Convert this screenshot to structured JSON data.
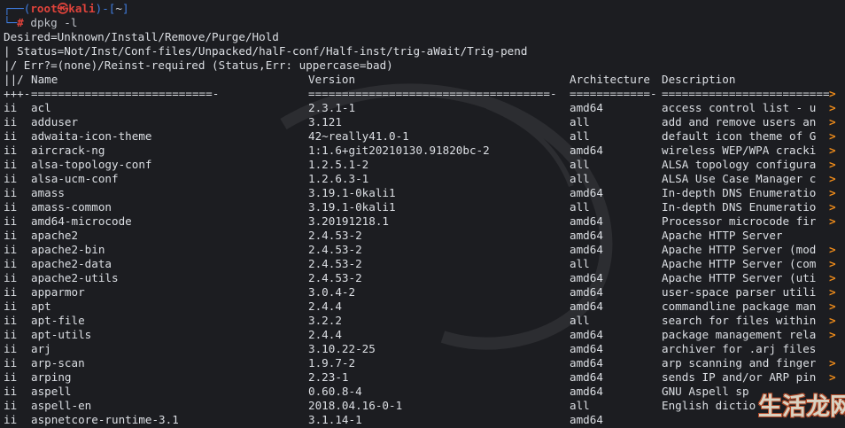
{
  "prompt": {
    "box_top": "┌──(",
    "user": "root㉿kali",
    "mid": ")-[",
    "cwd": "~",
    "close": "]",
    "box_bottom": "└─",
    "symbol": "#",
    "command": "dpkg -l"
  },
  "header": {
    "desired": "Desired=Unknown/Install/Remove/Purge/Hold",
    "status": "| Status=Not/Inst/Conf-files/Unpacked/halF-conf/Half-inst/trig-aWait/Trig-pend",
    "err": "|/ Err?=(none)/Reinst-required (Status,Err: uppercase=bad)",
    "col_flags": "||/",
    "col_name": "Name",
    "col_version": "Version",
    "col_arch": "Architecture",
    "col_desc": "Description",
    "rule_flags": "+++-",
    "rule_name": "===========================-",
    "rule_version": "====================================-",
    "rule_arch": "============-",
    "rule_desc": "===========================",
    "overflow_arrow": ">"
  },
  "packages": [
    {
      "status": "ii",
      "name": "acl",
      "version": "2.3.1-1",
      "arch": "amd64",
      "desc": "access control list - u",
      "more": ">"
    },
    {
      "status": "ii",
      "name": "adduser",
      "version": "3.121",
      "arch": "all",
      "desc": "add and remove users an",
      "more": ">"
    },
    {
      "status": "ii",
      "name": "adwaita-icon-theme",
      "version": "42~really41.0-1",
      "arch": "all",
      "desc": "default icon theme of G",
      "more": ">"
    },
    {
      "status": "ii",
      "name": "aircrack-ng",
      "version": "1:1.6+git20210130.91820bc-2",
      "arch": "amd64",
      "desc": "wireless WEP/WPA cracki",
      "more": ">"
    },
    {
      "status": "ii",
      "name": "alsa-topology-conf",
      "version": "1.2.5.1-2",
      "arch": "all",
      "desc": "ALSA topology configura",
      "more": ">"
    },
    {
      "status": "ii",
      "name": "alsa-ucm-conf",
      "version": "1.2.6.3-1",
      "arch": "all",
      "desc": "ALSA Use Case Manager c",
      "more": ">"
    },
    {
      "status": "ii",
      "name": "amass",
      "version": "3.19.1-0kali1",
      "arch": "amd64",
      "desc": "In-depth DNS Enumeratio",
      "more": ">"
    },
    {
      "status": "ii",
      "name": "amass-common",
      "version": "3.19.1-0kali1",
      "arch": "all",
      "desc": "In-depth DNS Enumeratio",
      "more": ">"
    },
    {
      "status": "ii",
      "name": "amd64-microcode",
      "version": "3.20191218.1",
      "arch": "amd64",
      "desc": "Processor microcode fir",
      "more": ">"
    },
    {
      "status": "ii",
      "name": "apache2",
      "version": "2.4.53-2",
      "arch": "amd64",
      "desc": "Apache HTTP Server",
      "more": ""
    },
    {
      "status": "ii",
      "name": "apache2-bin",
      "version": "2.4.53-2",
      "arch": "amd64",
      "desc": "Apache HTTP Server (mod",
      "more": ">"
    },
    {
      "status": "ii",
      "name": "apache2-data",
      "version": "2.4.53-2",
      "arch": "all",
      "desc": "Apache HTTP Server (com",
      "more": ">"
    },
    {
      "status": "ii",
      "name": "apache2-utils",
      "version": "2.4.53-2",
      "arch": "amd64",
      "desc": "Apache HTTP Server (uti",
      "more": ">"
    },
    {
      "status": "ii",
      "name": "apparmor",
      "version": "3.0.4-2",
      "arch": "amd64",
      "desc": "user-space parser utili",
      "more": ">"
    },
    {
      "status": "ii",
      "name": "apt",
      "version": "2.4.4",
      "arch": "amd64",
      "desc": "commandline package man",
      "more": ">"
    },
    {
      "status": "ii",
      "name": "apt-file",
      "version": "3.2.2",
      "arch": "all",
      "desc": "search for files within",
      "more": ">"
    },
    {
      "status": "ii",
      "name": "apt-utils",
      "version": "2.4.4",
      "arch": "amd64",
      "desc": "package management rela",
      "more": ">"
    },
    {
      "status": "ii",
      "name": "arj",
      "version": "3.10.22-25",
      "arch": "amd64",
      "desc": "archiver for .arj files",
      "more": ""
    },
    {
      "status": "ii",
      "name": "arp-scan",
      "version": "1.9.7-2",
      "arch": "amd64",
      "desc": "arp scanning and finger",
      "more": ">"
    },
    {
      "status": "ii",
      "name": "arping",
      "version": "2.23-1",
      "arch": "amd64",
      "desc": "sends IP and/or ARP pin",
      "more": ">"
    },
    {
      "status": "ii",
      "name": "aspell",
      "version": "0.60.8-4",
      "arch": "amd64",
      "desc": "GNU Aspell sp",
      "more": ""
    },
    {
      "status": "ii",
      "name": "aspell-en",
      "version": "2018.04.16-0-1",
      "arch": "all",
      "desc": "English dictio",
      "more": ""
    },
    {
      "status": "ii",
      "name": "aspnetcore-runtime-3.1",
      "version": "3.1.14-1",
      "arch": "amd64",
      "desc": "",
      "more": ""
    }
  ],
  "watermark": "生活龙网",
  "colors": {
    "background": "#1c1d21",
    "text": "#dcdfe4",
    "prompt_frame": "#3f7de0",
    "prompt_user": "#e0433b",
    "overflow_arrow": "#f08c1a"
  }
}
